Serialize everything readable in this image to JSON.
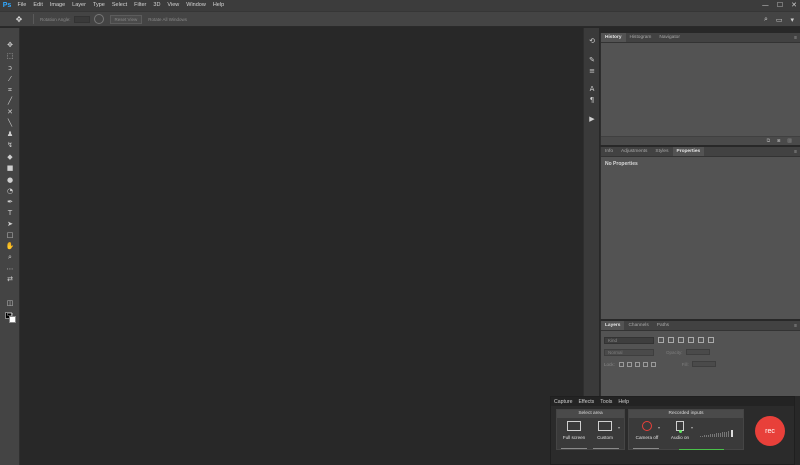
{
  "app": {
    "logo": "Ps"
  },
  "menu": [
    "File",
    "Edit",
    "Image",
    "Layer",
    "Type",
    "Select",
    "Filter",
    "3D",
    "View",
    "Window",
    "Help"
  ],
  "window_controls": {
    "minimize": "—",
    "maximize": "☐",
    "close": "✕"
  },
  "options_bar": {
    "tool_icon": "✥",
    "rotate_label": "Rotation Angle:",
    "reset_view": "Reset View",
    "rotate_all": "Rotate All Windows"
  },
  "panels": {
    "top": {
      "tabs": [
        "History",
        "Histogram",
        "Navigator"
      ],
      "active": 0
    },
    "middle": {
      "tabs": [
        "Info",
        "Adjustments",
        "Styles",
        "Properties"
      ],
      "active": 3,
      "content": "No Properties"
    },
    "bottom": {
      "tabs": [
        "Layers",
        "Channels",
        "Paths"
      ],
      "active": 0,
      "kind_placeholder": "Kind",
      "blend_mode": "Normal",
      "opacity_label": "Opacity:",
      "lock_label": "Lock:",
      "fill_label": "Fill:"
    }
  },
  "recorder": {
    "menu": [
      "Capture",
      "Effects",
      "Tools",
      "Help"
    ],
    "select_area": {
      "title": "Select area",
      "options": [
        "Full screen",
        "Custom"
      ]
    },
    "recorded_inputs": {
      "title": "Recorded inputs",
      "options": [
        "Camera off",
        "Audio on"
      ]
    },
    "rec_label": "rec",
    "colors": {
      "rec": "#e8403a",
      "level": "#4ac14a"
    }
  }
}
